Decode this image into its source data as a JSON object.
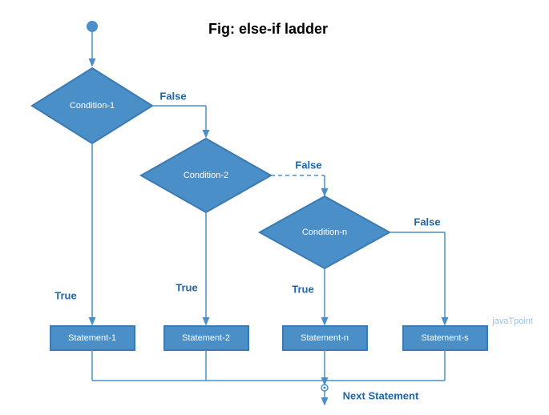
{
  "chart_data": {
    "type": "flowchart",
    "title": "Fig: else-if ladder",
    "nodes": [
      {
        "id": "start",
        "type": "start",
        "label": ""
      },
      {
        "id": "c1",
        "type": "decision",
        "label": "Condition-1"
      },
      {
        "id": "c2",
        "type": "decision",
        "label": "Condition-2"
      },
      {
        "id": "cn",
        "type": "decision",
        "label": "Condition-n"
      },
      {
        "id": "s1",
        "type": "process",
        "label": "Statement-1"
      },
      {
        "id": "s2",
        "type": "process",
        "label": "Statement-2"
      },
      {
        "id": "sn",
        "type": "process",
        "label": "Statement-n"
      },
      {
        "id": "ss",
        "type": "process",
        "label": "Statement-s"
      },
      {
        "id": "next",
        "type": "end",
        "label": "Next Statement"
      }
    ],
    "edges": [
      {
        "from": "start",
        "to": "c1",
        "label": ""
      },
      {
        "from": "c1",
        "to": "s1",
        "label": "True"
      },
      {
        "from": "c1",
        "to": "c2",
        "label": "False"
      },
      {
        "from": "c2",
        "to": "s2",
        "label": "True"
      },
      {
        "from": "c2",
        "to": "cn",
        "label": "False",
        "style": "dashed"
      },
      {
        "from": "cn",
        "to": "sn",
        "label": "True"
      },
      {
        "from": "cn",
        "to": "ss",
        "label": "False"
      },
      {
        "from": "s1",
        "to": "next",
        "label": ""
      },
      {
        "from": "s2",
        "to": "next",
        "label": ""
      },
      {
        "from": "sn",
        "to": "next",
        "label": ""
      },
      {
        "from": "ss",
        "to": "next",
        "label": ""
      }
    ]
  },
  "watermark": "javaTpoint"
}
